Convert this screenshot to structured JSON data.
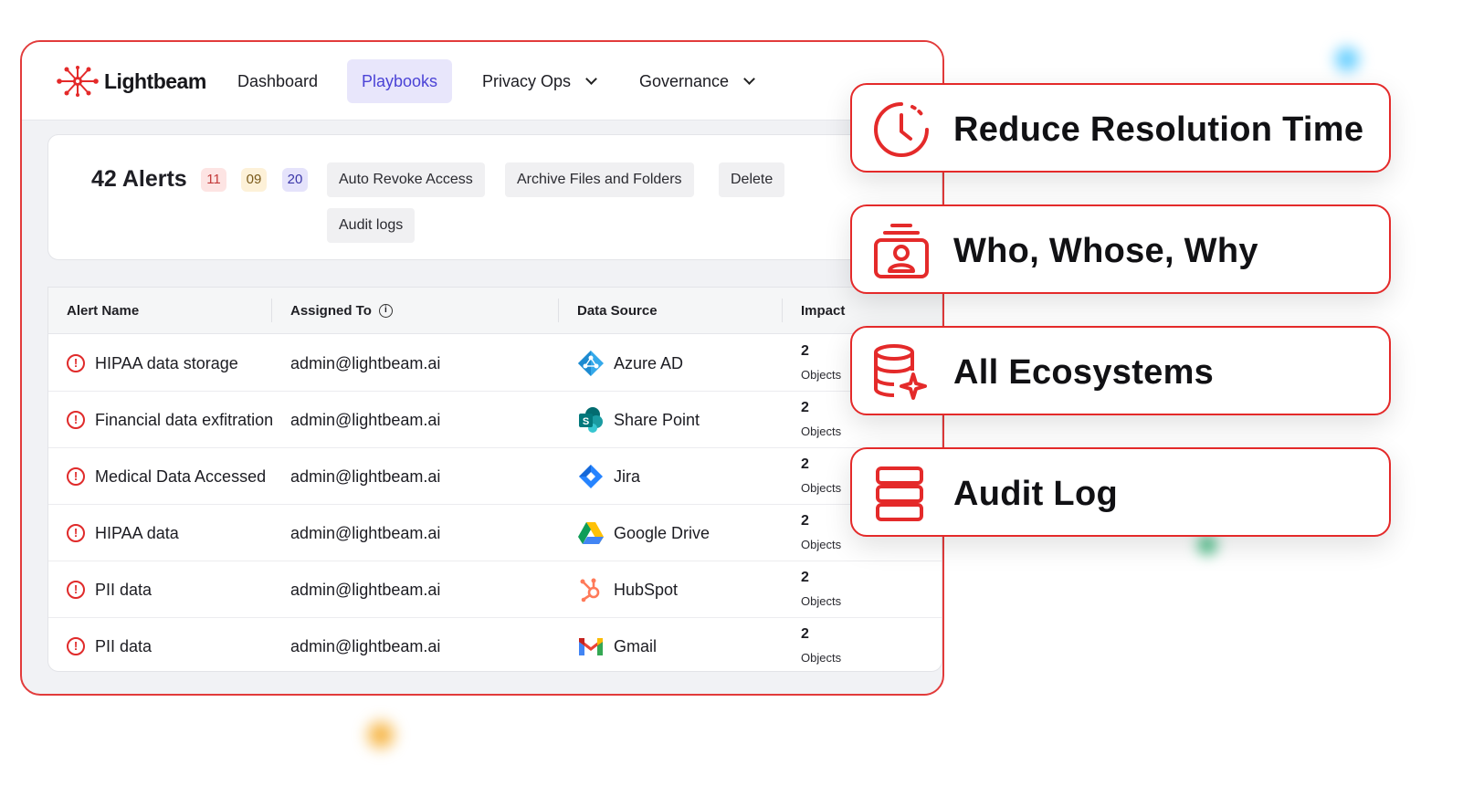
{
  "brand": {
    "name": "Lightbeam",
    "accent_color": "#e42a2a"
  },
  "nav": {
    "items": [
      {
        "label": "Dashboard",
        "active": false
      },
      {
        "label": "Playbooks",
        "active": true
      },
      {
        "label": "Privacy Ops",
        "active": false,
        "dropdown": true
      },
      {
        "label": "Governance",
        "active": false,
        "dropdown": true
      }
    ]
  },
  "toolbar": {
    "title": "42 Alerts",
    "badges": {
      "critical": "11",
      "warning": "09",
      "info": "20"
    },
    "actions": {
      "auto_revoke": "Auto Revoke Access",
      "archive": "Archive Files and Folders",
      "delete": "Delete",
      "audit_logs": "Audit logs"
    }
  },
  "table": {
    "columns": {
      "alert_name": "Alert Name",
      "assigned_to": "Assigned To",
      "data_source": "Data Source",
      "impact": "Impact"
    },
    "rows": [
      {
        "alert": "HIPAA data storage",
        "assignee": "admin@lightbeam.ai",
        "source": "Azure AD",
        "source_icon": "azure-ad-icon",
        "impact_count": "2",
        "impact_unit": "Objects"
      },
      {
        "alert": "Financial data exfitration",
        "assignee": "admin@lightbeam.ai",
        "source": "Share Point",
        "source_icon": "sharepoint-icon",
        "impact_count": "2",
        "impact_unit": "Objects"
      },
      {
        "alert": "Medical Data Accessed",
        "assignee": "admin@lightbeam.ai",
        "source": "Jira",
        "source_icon": "jira-icon",
        "impact_count": "2",
        "impact_unit": "Objects"
      },
      {
        "alert": "HIPAA data",
        "assignee": "admin@lightbeam.ai",
        "source": "Google Drive",
        "source_icon": "google-drive-icon",
        "impact_count": "2",
        "impact_unit": "Objects"
      },
      {
        "alert": "PII data",
        "assignee": "admin@lightbeam.ai",
        "source": "HubSpot",
        "source_icon": "hubspot-icon",
        "impact_count": "2",
        "impact_unit": "Objects"
      },
      {
        "alert": "PII data",
        "assignee": "admin@lightbeam.ai",
        "source": "Gmail",
        "source_icon": "gmail-icon",
        "impact_count": "2",
        "impact_unit": "Objects"
      }
    ]
  },
  "features": [
    {
      "label": "Reduce Resolution Time",
      "icon": "clock-icon"
    },
    {
      "label": "Who, Whose, Why",
      "icon": "id-badge-icon"
    },
    {
      "label": "All Ecosystems",
      "icon": "database-sparkle-icon"
    },
    {
      "label": "Audit Log",
      "icon": "server-stack-icon"
    }
  ]
}
